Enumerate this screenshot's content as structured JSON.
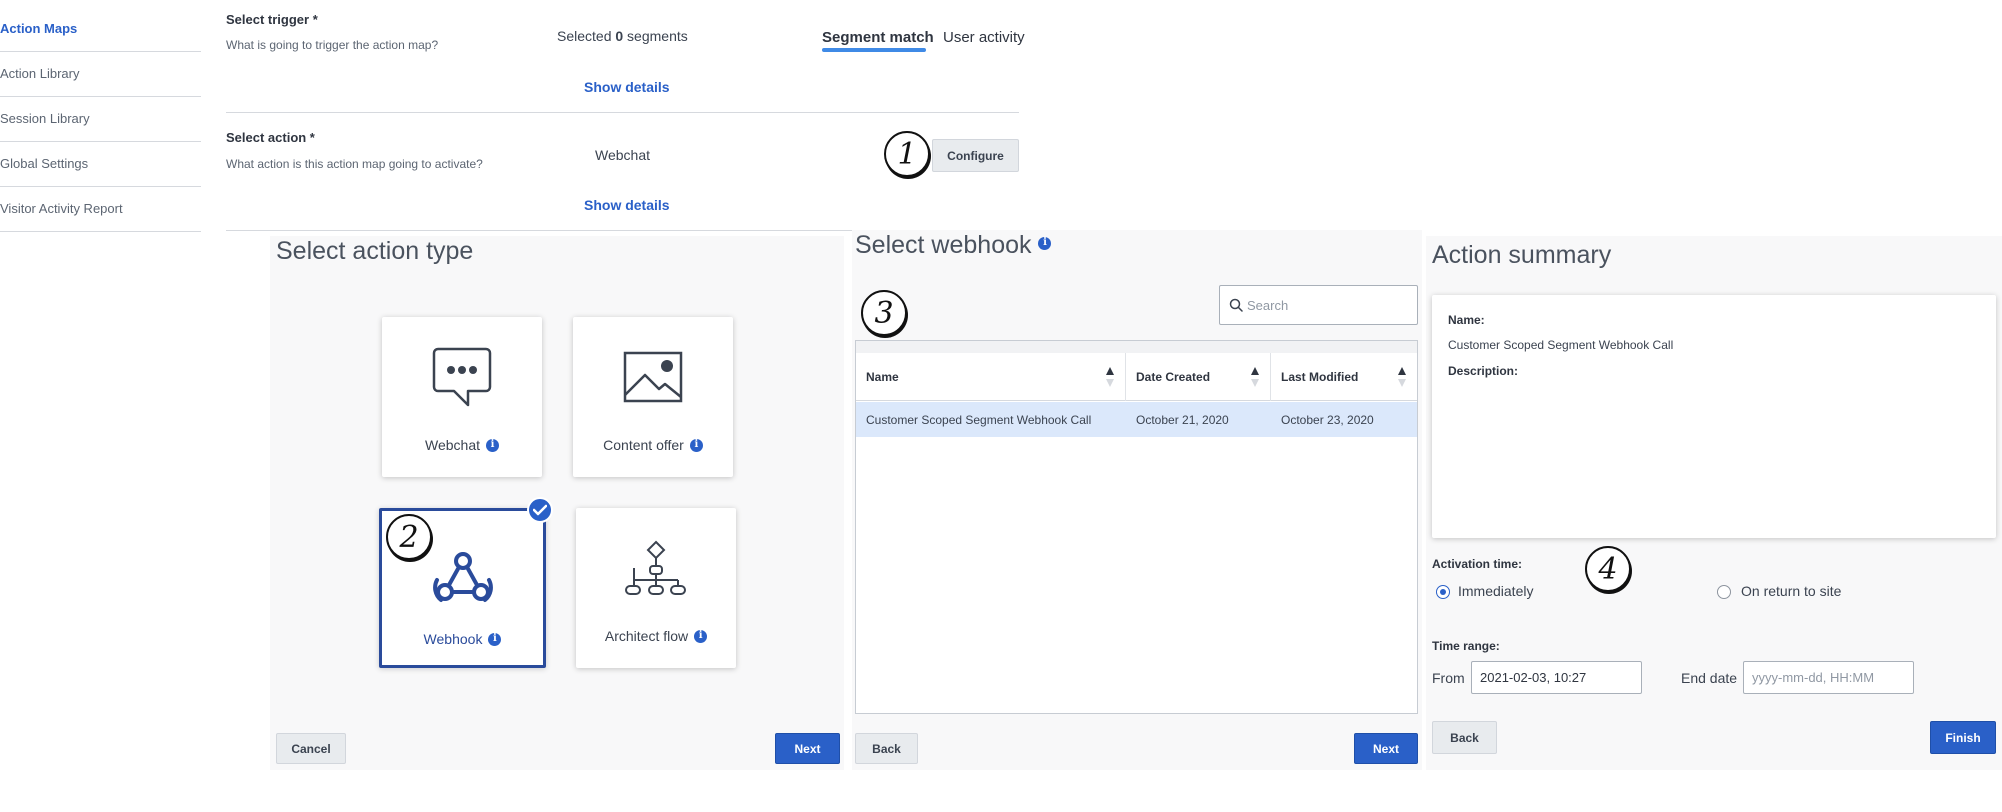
{
  "sidebar": {
    "items": [
      {
        "label": "Action Maps",
        "active": true
      },
      {
        "label": "Action Library",
        "active": false
      },
      {
        "label": "Session Library",
        "active": false
      },
      {
        "label": "Global Settings",
        "active": false
      },
      {
        "label": "Visitor Activity Report",
        "active": false
      }
    ]
  },
  "trigger": {
    "title": "Select trigger *",
    "subtitle": "What is going to trigger the action map?",
    "selected_prefix": "Selected ",
    "selected_count": "0",
    "selected_suffix": " segments",
    "show_details": "Show details",
    "tabs": [
      {
        "label": "Segment match",
        "active": true
      },
      {
        "label": "User activity",
        "active": false
      }
    ]
  },
  "action": {
    "title": "Select action *",
    "subtitle": "What action is this action map going to activate?",
    "value": "Webchat",
    "show_details": "Show details",
    "configure_label": "Configure"
  },
  "annotations": [
    "1",
    "2",
    "3",
    "4"
  ],
  "action_type": {
    "title": "Select action type",
    "cards": [
      {
        "label": "Webchat",
        "icon": "chat-bubble-icon",
        "selected": false
      },
      {
        "label": "Content offer",
        "icon": "image-icon",
        "selected": false
      },
      {
        "label": "Webhook",
        "icon": "webhook-icon",
        "selected": true
      },
      {
        "label": "Architect flow",
        "icon": "flow-icon",
        "selected": false
      }
    ],
    "cancel_label": "Cancel",
    "next_label": "Next"
  },
  "webhook": {
    "title": "Select webhook",
    "search_placeholder": "Search",
    "columns": [
      "Name",
      "Date Created",
      "Last Modified"
    ],
    "rows": [
      {
        "name": "Customer Scoped Segment Webhook Call",
        "created": "October 21, 2020",
        "modified": "October 23, 2020"
      }
    ],
    "back_label": "Back",
    "next_label": "Next"
  },
  "summary": {
    "title": "Action summary",
    "name_label": "Name:",
    "name_value": "Customer Scoped Segment Webhook Call",
    "description_label": "Description:",
    "activation_label": "Activation time:",
    "activation_options": [
      {
        "label": "Immediately",
        "selected": true
      },
      {
        "label": "On return to site",
        "selected": false
      }
    ],
    "time_range_label": "Time range:",
    "from_label": "From",
    "from_value": "2021-02-03, 10:27",
    "end_label": "End date",
    "end_placeholder": "yyyy-mm-dd, HH:MM",
    "back_label": "Back",
    "finish_label": "Finish"
  },
  "colors": {
    "accent": "#2a60c8",
    "selected_row": "#dbe8fb",
    "panel_bg": "#f8f8f9"
  }
}
